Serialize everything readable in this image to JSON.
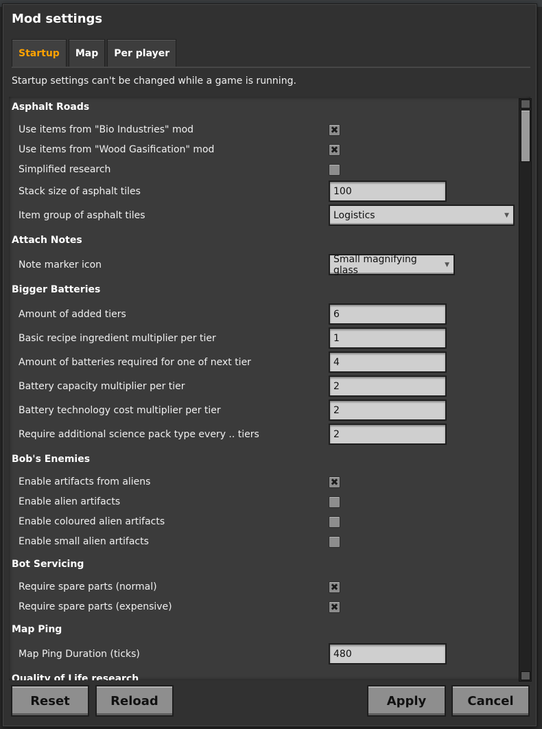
{
  "window": {
    "title": "Mod settings"
  },
  "tabs": [
    {
      "label": "Startup",
      "active": true
    },
    {
      "label": "Map",
      "active": false
    },
    {
      "label": "Per player",
      "active": false
    }
  ],
  "notice": "Startup settings can't be changed while a game is running.",
  "sections": {
    "asphalt": {
      "title": "Asphalt Roads",
      "bio": {
        "label": "Use items from \"Bio Industries\" mod",
        "checked": true
      },
      "wood": {
        "label": "Use items from \"Wood Gasification\" mod",
        "checked": true
      },
      "simplified": {
        "label": "Simplified research",
        "checked": false
      },
      "stack": {
        "label": "Stack size of asphalt tiles",
        "value": "100"
      },
      "group": {
        "label": "Item group of asphalt tiles",
        "value": "Logistics"
      }
    },
    "notes": {
      "title": "Attach Notes",
      "icon": {
        "label": "Note marker icon",
        "value": "Small magnifying glass"
      }
    },
    "batteries": {
      "title": "Bigger Batteries",
      "tiers": {
        "label": "Amount of added tiers",
        "value": "6"
      },
      "basic": {
        "label": "Basic recipe ingredient multiplier per tier",
        "value": "1"
      },
      "amount": {
        "label": "Amount of batteries required for one of next tier",
        "value": "4"
      },
      "capacity": {
        "label": "Battery capacity multiplier per tier",
        "value": "2"
      },
      "tech": {
        "label": "Battery technology cost multiplier per tier",
        "value": "2"
      },
      "science": {
        "label": "Require additional science pack type every .. tiers",
        "value": "2"
      }
    },
    "enemies": {
      "title": "Bob's Enemies",
      "from_aliens": {
        "label": "Enable artifacts from aliens",
        "checked": true
      },
      "alien": {
        "label": "Enable alien artifacts",
        "checked": false
      },
      "coloured": {
        "label": "Enable coloured alien artifacts",
        "checked": false
      },
      "small": {
        "label": "Enable small alien artifacts",
        "checked": false
      }
    },
    "bots": {
      "title": "Bot Servicing",
      "normal": {
        "label": "Require spare parts (normal)",
        "checked": true
      },
      "expensive": {
        "label": "Require spare parts (expensive)",
        "checked": true
      }
    },
    "ping": {
      "title": "Map Ping",
      "duration": {
        "label": "Map Ping Duration (ticks)",
        "value": "480"
      }
    },
    "qol": {
      "title": "Quality of Life research"
    }
  },
  "checkmark_glyph": "✖",
  "dropdown_arrow_glyph": "▼",
  "buttons": {
    "reset": "Reset",
    "reload": "Reload",
    "apply": "Apply",
    "cancel": "Cancel"
  }
}
